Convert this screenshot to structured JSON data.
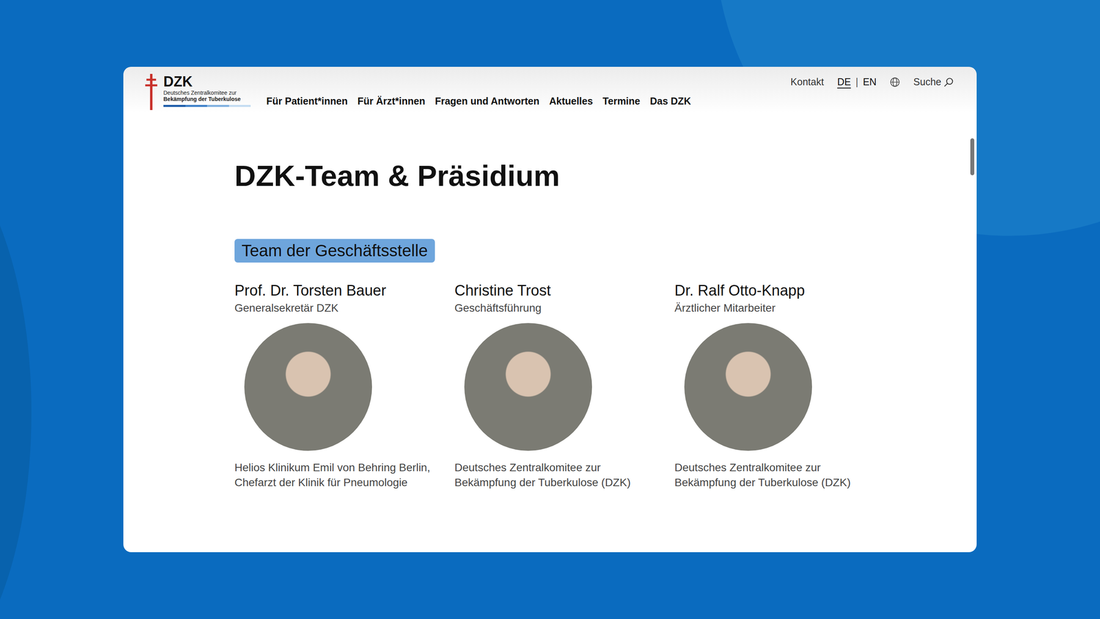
{
  "logo": {
    "short": "DZK",
    "line1": "Deutsches Zentralkomitee zur",
    "line2": "Bekämpfung der Tuberkulose"
  },
  "nav": [
    "Für Patient*innen",
    "Für Ärzt*innen",
    "Fragen und Antworten",
    "Aktuelles",
    "Termine",
    "Das DZK"
  ],
  "utility": {
    "contact": "Kontakt",
    "languages": [
      {
        "label": "DE",
        "selected": true
      },
      {
        "label": "EN",
        "selected": false
      }
    ],
    "separator": "|",
    "search": "Suche"
  },
  "page": {
    "title": "DZK-Team & Präsidium"
  },
  "section": {
    "title": "Team der Geschäftsstelle",
    "members": [
      {
        "name": "Prof. Dr. Torsten Bauer",
        "role": "Generalsekretär DZK",
        "affiliation": "Helios Klinikum Emil von Behring Berlin, Chefarzt der Klinik für Pneumologie"
      },
      {
        "name": "Christine Trost",
        "role": "Geschäftsführung",
        "affiliation": "Deutsches Zentralkomitee zur Bekämpfung der Tuberkulose (DZK)"
      },
      {
        "name": "Dr. Ralf Otto-Knapp",
        "role": "Ärztlicher Mitarbeiter",
        "affiliation": "Deutsches Zentralkomitee zur Bekämpfung der Tuberkulose (DZK)"
      }
    ]
  }
}
